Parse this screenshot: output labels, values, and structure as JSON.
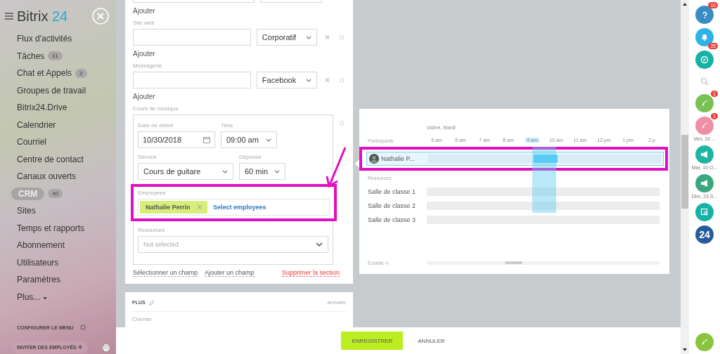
{
  "sidebar": {
    "logo": {
      "name": "Bitrix",
      "accent": "24"
    },
    "items": [
      {
        "label": "Flux d'activités",
        "kind": "link"
      },
      {
        "label": "Tâches",
        "counter": "11",
        "kind": "link"
      },
      {
        "label": "Chat et Appels",
        "counter": "2",
        "kind": "link"
      },
      {
        "label": "Groupes de travail",
        "kind": "link"
      },
      {
        "label": "Bitrix24.Drive",
        "kind": "link"
      },
      {
        "label": "Calendrier",
        "kind": "link"
      },
      {
        "label": "Courriel",
        "kind": "link"
      },
      {
        "label": "Centre de contact",
        "kind": "link"
      },
      {
        "label": "Canaux ouverts",
        "kind": "link"
      },
      {
        "label": "CRM",
        "counter": "40",
        "kind": "pill"
      },
      {
        "label": "Sites",
        "kind": "link"
      },
      {
        "label": "Temps et rapports",
        "kind": "link"
      },
      {
        "label": "Abonnement",
        "kind": "link"
      },
      {
        "label": "Utilisateurs",
        "kind": "link"
      },
      {
        "label": "Paramètres",
        "kind": "link"
      },
      {
        "label": "Plus...",
        "kind": "more"
      }
    ],
    "configure": "CONFIGURER LE MENU",
    "invite": "INVITER DES EMPLOYÉS"
  },
  "form": {
    "top_add_link": "Ajouter",
    "contact_groups": [
      {
        "label": "Site web",
        "type": "Corporatif",
        "add_link": "Ajouter"
      },
      {
        "label": "Messagerie",
        "type": "Facebook",
        "add_link": "Ajouter"
      }
    ],
    "section": {
      "title": "Cours de musique",
      "date": {
        "label": "Date de début",
        "value": "10/30/2018"
      },
      "time": {
        "label": "Time",
        "value": "09:00 am"
      },
      "service": {
        "label": "Service",
        "value": "Cours de guitare"
      },
      "duration": {
        "label": "Dépensé",
        "value": "60 min"
      },
      "employees": {
        "label": "Employees",
        "tags": [
          "Nathalie Perrin"
        ],
        "link": "Select employees"
      },
      "resources": {
        "label": "Resources",
        "placeholder": "Not selected"
      }
    },
    "links": [
      {
        "label": "Sélectionner un champ",
        "kind": "normal"
      },
      {
        "label": "Ajouter un champ",
        "kind": "normal"
      },
      {
        "label": "Supprimer la section",
        "kind": "danger"
      }
    ]
  },
  "plus_panel": {
    "title": "PLUS",
    "cancel": "annuler",
    "field_label": "Chemin"
  },
  "scheduler": {
    "date": "ctobre, Mardi",
    "participants_label": "Participants",
    "participants": [
      "Nathalie P..."
    ],
    "hours": [
      {
        "label": "5 am",
        "selected": false
      },
      {
        "label": "6 am",
        "selected": false
      },
      {
        "label": "7 am",
        "selected": false
      },
      {
        "label": "8 am",
        "selected": false
      },
      {
        "label": "9 am",
        "selected": true
      },
      {
        "label": "10 am",
        "selected": false
      },
      {
        "label": "11 am",
        "selected": false
      },
      {
        "label": "12 pm",
        "selected": false
      },
      {
        "label": "1 pm",
        "selected": false
      },
      {
        "label": "2 p",
        "selected": false
      }
    ],
    "resources_label": "Resources",
    "resources": [
      "Salle de classe 1",
      "Salle de classe 2",
      "Salle de classe 3"
    ],
    "scale_label": "Échelle"
  },
  "footer": {
    "buttons": [
      {
        "label": "ENREGISTRER",
        "kind": "primary"
      },
      {
        "label": "ANNULER",
        "kind": "plain"
      }
    ]
  },
  "right_bar": {
    "items": [
      {
        "kind": "help",
        "color": "#3a8dc3",
        "badge": "10"
      },
      {
        "kind": "bell",
        "color": "#2fb3e6",
        "badge": "25"
      },
      {
        "kind": "chat",
        "color": "#17b2a6"
      },
      {
        "kind": "search"
      },
      {
        "kind": "phone",
        "color": "#79c252",
        "badge": "1"
      },
      {
        "kind": "phone",
        "color": "#ef8fa6",
        "badge": "1"
      },
      {
        "kind": "date",
        "label": "Ven, 19 ..."
      },
      {
        "kind": "megaphone",
        "color": "#1fb5a2"
      },
      {
        "kind": "date",
        "label": "Mar, 10 O..."
      },
      {
        "kind": "megaphone",
        "color": "#3aa77e"
      },
      {
        "kind": "date",
        "label": "Dim, 23 S..."
      },
      {
        "kind": "screen",
        "color": "#17b2a6"
      },
      {
        "kind": "logo",
        "color": "#265c9c",
        "label": "24"
      }
    ]
  }
}
